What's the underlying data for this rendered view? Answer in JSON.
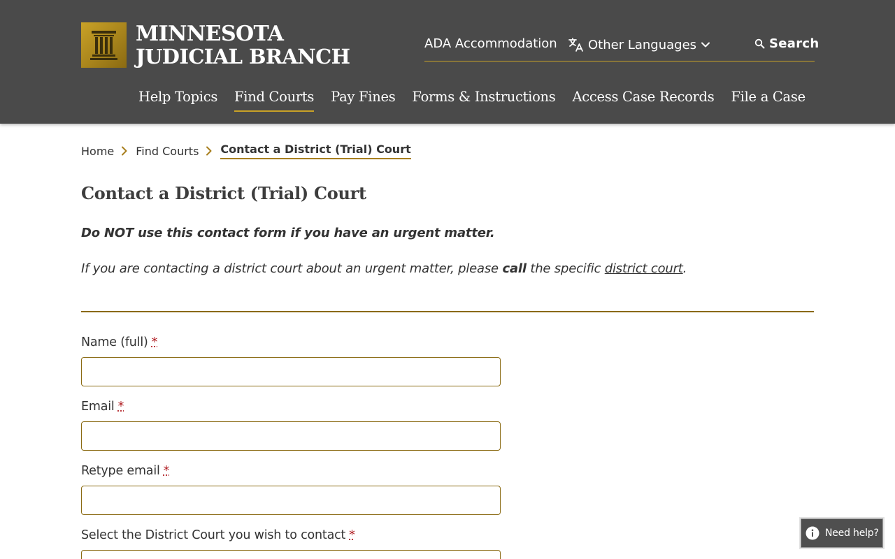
{
  "header": {
    "logo": {
      "line1": "MINNESOTA",
      "line2": "JUDICIAL BRANCH"
    },
    "utility": {
      "ada": "ADA Accommodation",
      "languages": "Other Languages",
      "search": "Search"
    },
    "nav": [
      {
        "label": "Help Topics"
      },
      {
        "label": "Find Courts"
      },
      {
        "label": "Pay Fines"
      },
      {
        "label": "Forms & Instructions"
      },
      {
        "label": "Access Case Records"
      },
      {
        "label": "File a Case"
      }
    ]
  },
  "breadcrumb": {
    "items": [
      "Home",
      "Find Courts"
    ],
    "current": "Contact a District (Trial) Court"
  },
  "page": {
    "title": "Contact a District (Trial) Court",
    "warning_strong": "Do NOT use this contact form if you have an urgent matter.",
    "warning_body_before": "If you are contacting a district court about an urgent matter, please ",
    "warning_body_bold": "call",
    "warning_body_middle": " the specific ",
    "warning_body_link": "district court",
    "warning_body_after": "."
  },
  "form": {
    "required_mark": "*",
    "fields": [
      {
        "label": "Name (full)",
        "value": ""
      },
      {
        "label": "Email",
        "value": ""
      },
      {
        "label": "Retype email",
        "value": ""
      },
      {
        "label": "Select the District Court you wish to contact",
        "value": ""
      }
    ]
  },
  "help_widget": {
    "label": "Need help?"
  },
  "colors": {
    "header_bg": "#4a4a4a",
    "accent_gold": "#c9a227",
    "input_border": "#8a6a12",
    "required_red": "#b01e23"
  }
}
